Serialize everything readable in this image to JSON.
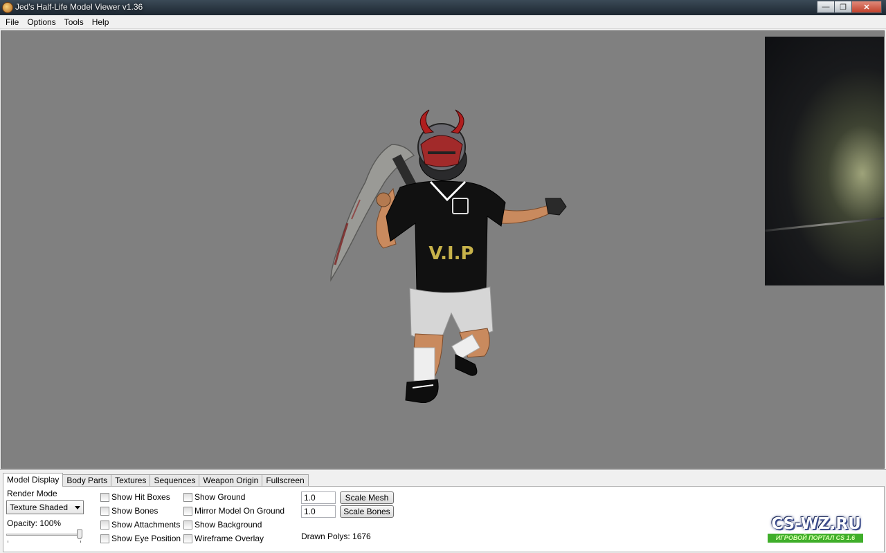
{
  "window": {
    "title": "Jed's Half-Life Model Viewer v1.36",
    "minimize": "—",
    "maximize": "❐",
    "close": "✕"
  },
  "menu": [
    "File",
    "Options",
    "Tools",
    "Help"
  ],
  "model": {
    "shirt_text": "V.I.P"
  },
  "tabs": [
    "Model Display",
    "Body Parts",
    "Textures",
    "Sequences",
    "Weapon Origin",
    "Fullscreen"
  ],
  "active_tab": "Model Display",
  "model_display": {
    "render_mode_label": "Render Mode",
    "render_mode_value": "Texture Shaded",
    "opacity_label": "Opacity: 100%",
    "opacity_value": 1.0,
    "checkboxes_col1": [
      "Show Hit Boxes",
      "Show Bones",
      "Show Attachments",
      "Show Eye Position"
    ],
    "checkboxes_col2": [
      "Show Ground",
      "Mirror Model On Ground",
      "Show Background",
      "Wireframe Overlay"
    ],
    "scale_mesh_value": "1.0",
    "scale_mesh_button": "Scale Mesh",
    "scale_bones_value": "1.0",
    "scale_bones_button": "Scale Bones",
    "drawn_polys": "Drawn Polys: 1676"
  },
  "watermark": {
    "main": "CS-WZ.RU",
    "sub": "ИГРОВОЙ ПОРТАЛ CS 1.6"
  }
}
